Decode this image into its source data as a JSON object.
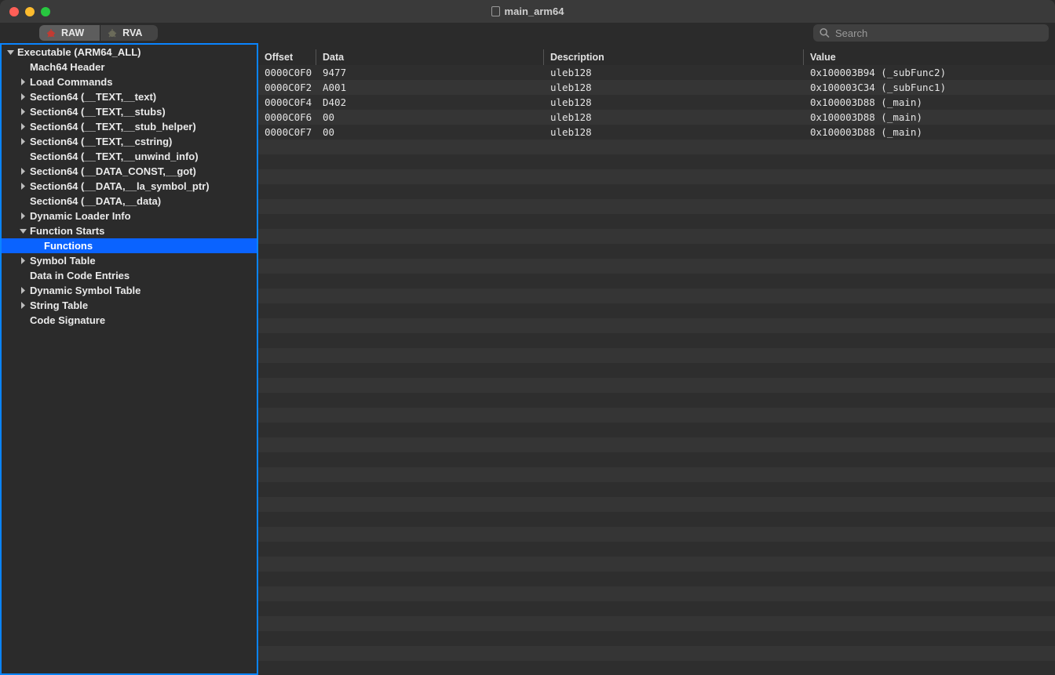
{
  "window": {
    "title": "main_arm64"
  },
  "toolbar": {
    "tabs": [
      {
        "label": "RAW",
        "active": true
      },
      {
        "label": "RVA",
        "active": false
      }
    ],
    "search_placeholder": "Search"
  },
  "sidebar": {
    "root_label": "Executable  (ARM64_ALL)",
    "items": [
      {
        "label": "Mach64 Header",
        "chev": null,
        "level": 1
      },
      {
        "label": "Load Commands",
        "chev": "right",
        "level": 1
      },
      {
        "label": "Section64 (__TEXT,__text)",
        "chev": "right",
        "level": 1
      },
      {
        "label": "Section64 (__TEXT,__stubs)",
        "chev": "right",
        "level": 1
      },
      {
        "label": "Section64 (__TEXT,__stub_helper)",
        "chev": "right",
        "level": 1
      },
      {
        "label": "Section64 (__TEXT,__cstring)",
        "chev": "right",
        "level": 1
      },
      {
        "label": "Section64 (__TEXT,__unwind_info)",
        "chev": null,
        "level": 1
      },
      {
        "label": "Section64 (__DATA_CONST,__got)",
        "chev": "right",
        "level": 1
      },
      {
        "label": "Section64 (__DATA,__la_symbol_ptr)",
        "chev": "right",
        "level": 1
      },
      {
        "label": "Section64 (__DATA,__data)",
        "chev": null,
        "level": 1
      },
      {
        "label": "Dynamic Loader Info",
        "chev": "right",
        "level": 1
      },
      {
        "label": "Function Starts",
        "chev": "down",
        "level": 1
      },
      {
        "label": "Functions",
        "chev": null,
        "level": 2,
        "selected": true
      },
      {
        "label": "Symbol Table",
        "chev": "right",
        "level": 1
      },
      {
        "label": "Data in Code Entries",
        "chev": null,
        "level": 1
      },
      {
        "label": "Dynamic Symbol Table",
        "chev": "right",
        "level": 1
      },
      {
        "label": "String Table",
        "chev": "right",
        "level": 1
      },
      {
        "label": "Code Signature",
        "chev": null,
        "level": 1
      }
    ]
  },
  "table": {
    "columns": [
      "Offset",
      "Data",
      "Description",
      "Value"
    ],
    "rows": [
      {
        "offset": "0000C0F0",
        "data": "9477",
        "desc": "uleb128",
        "value": "0x100003B94 (_subFunc2)"
      },
      {
        "offset": "0000C0F2",
        "data": "A001",
        "desc": "uleb128",
        "value": "0x100003C34 (_subFunc1)"
      },
      {
        "offset": "0000C0F4",
        "data": "D402",
        "desc": "uleb128",
        "value": "0x100003D88 (_main)"
      },
      {
        "offset": "0000C0F6",
        "data": "00",
        "desc": "uleb128",
        "value": "0x100003D88 (_main)"
      },
      {
        "offset": "0000C0F7",
        "data": "00",
        "desc": "uleb128",
        "value": "0x100003D88 (_main)"
      }
    ]
  }
}
